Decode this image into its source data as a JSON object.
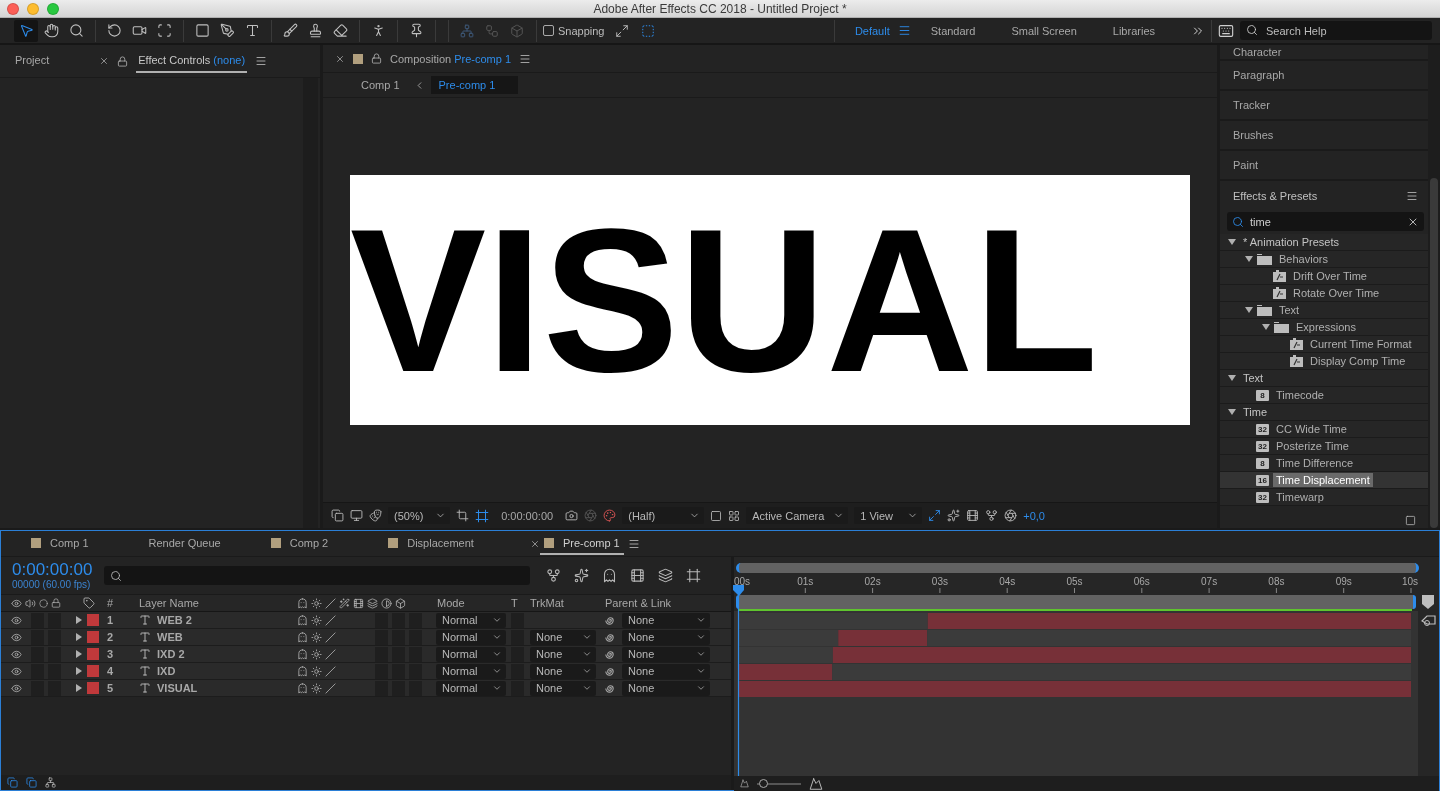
{
  "window": {
    "title": "Adobe After Effects CC 2018 - Untitled Project *"
  },
  "toolbar": {
    "snapping": {
      "label": "Snapping",
      "checked": false
    },
    "workspaces": [
      {
        "label": "Default",
        "selected": true
      },
      {
        "label": "Standard",
        "selected": false
      },
      {
        "label": "Small Screen",
        "selected": false
      },
      {
        "label": "Libraries",
        "selected": false
      }
    ],
    "search": {
      "placeholder": "Search Help"
    }
  },
  "left_panel": {
    "tabs": [
      {
        "label": "Project",
        "selected": false
      },
      {
        "label": "Effect Controls",
        "target": "(none)",
        "selected": true
      }
    ]
  },
  "composition": {
    "tab": {
      "label": "Composition",
      "target": "Pre-comp 1"
    },
    "breadcrumbs": [
      {
        "label": "Comp 1",
        "selected": false
      },
      {
        "label": "Pre-comp 1",
        "selected": true
      }
    ],
    "canvas_text": "VISUAL",
    "footer": {
      "zoom": "(50%)",
      "timecode": "0:00:00:00",
      "resolution": "(Half)",
      "camera": "Active Camera",
      "view": "1 View",
      "exposure": "+0,0"
    }
  },
  "right_panel": {
    "panels": [
      {
        "label": "Character"
      },
      {
        "label": "Paragraph"
      },
      {
        "label": "Tracker"
      },
      {
        "label": "Brushes"
      },
      {
        "label": "Paint"
      }
    ],
    "effects": {
      "title": "Effects & Presets",
      "search": "time",
      "tree": [
        {
          "label": "* Animation Presets",
          "kind": "category",
          "expanded": true,
          "selected": false,
          "children": [
            {
              "label": "Behaviors",
              "kind": "folder",
              "expanded": true,
              "selected": false,
              "children": [
                {
                  "label": "Drift Over Time",
                  "kind": "preset",
                  "selected": false
                },
                {
                  "label": "Rotate Over Time",
                  "kind": "preset",
                  "selected": false
                }
              ]
            },
            {
              "label": "Text",
              "kind": "folder",
              "expanded": true,
              "selected": false,
              "children": [
                {
                  "label": "Expressions",
                  "kind": "folder",
                  "expanded": true,
                  "selected": false,
                  "children": [
                    {
                      "label": "Current Time Format",
                      "kind": "preset",
                      "selected": false
                    },
                    {
                      "label": "Display Comp Time",
                      "kind": "preset",
                      "selected": false
                    }
                  ]
                }
              ]
            }
          ]
        },
        {
          "label": "Text",
          "kind": "category",
          "expanded": true,
          "selected": false,
          "children": [
            {
              "label": "Timecode",
              "kind": "effect",
              "badge": "8",
              "selected": false
            }
          ]
        },
        {
          "label": "Time",
          "kind": "category",
          "expanded": true,
          "selected": false,
          "children": [
            {
              "label": "CC Wide Time",
              "kind": "effect",
              "badge": "32",
              "selected": false
            },
            {
              "label": "Posterize Time",
              "kind": "effect",
              "badge": "32",
              "selected": false
            },
            {
              "label": "Time Difference",
              "kind": "effect",
              "badge": "8",
              "selected": false
            },
            {
              "label": "Time Displacement",
              "kind": "effect",
              "badge": "16",
              "selected": true
            },
            {
              "label": "Timewarp",
              "kind": "effect",
              "badge": "32",
              "selected": false
            }
          ]
        }
      ]
    }
  },
  "timeline": {
    "tabs": [
      {
        "label": "Comp 1",
        "kind": "comp",
        "selected": false
      },
      {
        "label": "Render Queue",
        "kind": "queue",
        "selected": false
      },
      {
        "label": "Comp 2",
        "kind": "comp",
        "selected": false
      },
      {
        "label": "Displacement",
        "kind": "comp",
        "selected": false
      },
      {
        "label": "Pre-comp 1",
        "kind": "comp",
        "selected": true
      }
    ],
    "timecode": "0:00:00:00",
    "frame_info": "00000 (60.00 fps)",
    "columns": {
      "number": "#",
      "name": "Layer Name",
      "mode": "Mode",
      "t": "T",
      "trkmat": "TrkMat",
      "parent": "Parent & Link"
    },
    "layers": [
      {
        "number": "1",
        "name": "WEB 2",
        "visible": true,
        "mode": "Normal",
        "parent": "None"
      },
      {
        "number": "2",
        "name": "WEB",
        "visible": true,
        "mode": "Normal",
        "trkmat": "None",
        "parent": "None"
      },
      {
        "number": "3",
        "name": "IXD 2",
        "visible": true,
        "mode": "Normal",
        "trkmat": "None",
        "parent": "None"
      },
      {
        "number": "4",
        "name": "IXD",
        "visible": true,
        "mode": "Normal",
        "trkmat": "None",
        "parent": "None"
      },
      {
        "number": "5",
        "name": "VISUAL",
        "visible": true,
        "mode": "Normal",
        "trkmat": "None",
        "parent": "None"
      }
    ],
    "zoom_slider": {
      "level": 0.05
    },
    "chart_data": {
      "type": "bar",
      "orientation": "horizontal",
      "stacked": true,
      "xlim": [
        0,
        10
      ],
      "xticks": [
        {
          "value": 0,
          "label": "00s"
        },
        {
          "value": 1,
          "label": "01s"
        },
        {
          "value": 2,
          "label": "02s"
        },
        {
          "value": 3,
          "label": "03s"
        },
        {
          "value": 4,
          "label": "04s"
        },
        {
          "value": 5,
          "label": "05s"
        },
        {
          "value": 6,
          "label": "06s"
        },
        {
          "value": 7,
          "label": "07s"
        },
        {
          "value": 8,
          "label": "08s"
        },
        {
          "value": 9,
          "label": "09s"
        },
        {
          "value": 10,
          "label": "10s"
        }
      ],
      "series": [
        {
          "color": "#3b3b3b",
          "values": [
            2.82,
            1.49,
            1.41,
            0,
            0
          ]
        },
        {
          "color": "#773038",
          "values": [
            7.18,
            1.32,
            8.59,
            1.4,
            10
          ]
        },
        {
          "color": "#3b3b3b",
          "values": [
            0,
            7.19,
            0,
            8.6,
            0
          ]
        }
      ]
    }
  }
}
